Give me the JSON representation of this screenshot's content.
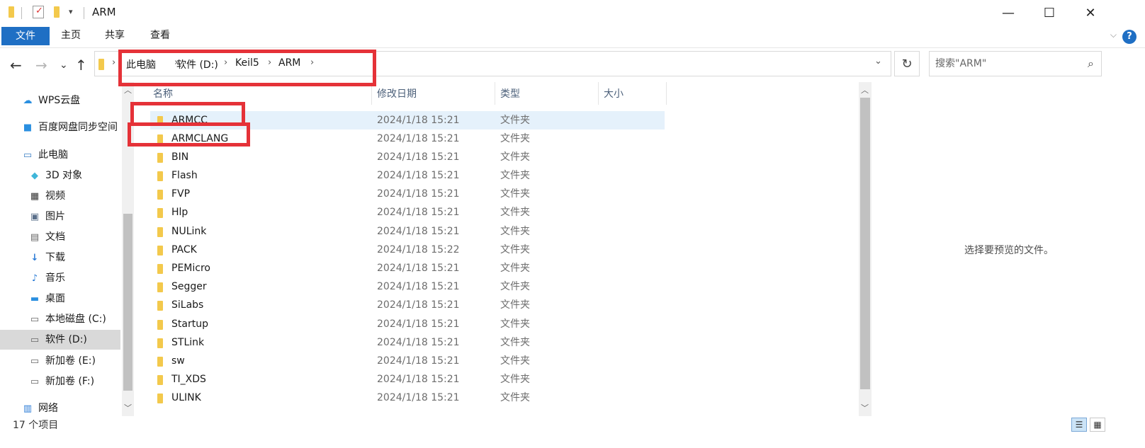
{
  "window": {
    "title": "ARM",
    "quick_access_dropdown": "▾",
    "controls": {
      "minimize": "—",
      "maximize": "☐",
      "close": "✕"
    }
  },
  "ribbon": {
    "tabs": [
      "文件",
      "主页",
      "共享",
      "查看"
    ],
    "help_label": "?",
    "expand_chevron": "⌵"
  },
  "nav": {
    "back": "←",
    "forward": "→",
    "recent": "⌄",
    "up": "↑",
    "breadcrumbs": [
      "此电脑",
      "软件 (D:)",
      "Keil5",
      "ARM"
    ],
    "address_dropdown": "⌄",
    "refresh": "↻",
    "search_placeholder": "搜索\"ARM\""
  },
  "sidebar": {
    "items": [
      {
        "label": "WPS云盘",
        "icon": "cloud-icon"
      },
      {
        "label": "百度网盘同步空间",
        "icon": "baidu-netdisk-icon"
      },
      {
        "label": "此电脑",
        "icon": "computer-icon"
      },
      {
        "label": "3D 对象",
        "icon": "3d-objects-icon"
      },
      {
        "label": "视频",
        "icon": "video-icon"
      },
      {
        "label": "图片",
        "icon": "pictures-icon"
      },
      {
        "label": "文档",
        "icon": "documents-icon"
      },
      {
        "label": "下载",
        "icon": "download-icon"
      },
      {
        "label": "音乐",
        "icon": "music-icon"
      },
      {
        "label": "桌面",
        "icon": "desktop-icon"
      },
      {
        "label": "本地磁盘 (C:)",
        "icon": "drive-icon"
      },
      {
        "label": "软件 (D:)",
        "icon": "drive-icon",
        "selected": true
      },
      {
        "label": "新加卷 (E:)",
        "icon": "drive-icon"
      },
      {
        "label": "新加卷 (F:)",
        "icon": "drive-icon"
      },
      {
        "label": "网络",
        "icon": "network-icon"
      }
    ]
  },
  "list": {
    "columns": [
      "名称",
      "修改日期",
      "类型",
      "大小"
    ],
    "rows": [
      {
        "name": "ARMCC",
        "date": "2024/1/18 15:21",
        "type": "文件夹"
      },
      {
        "name": "ARMCLANG",
        "date": "2024/1/18 15:21",
        "type": "文件夹"
      },
      {
        "name": "BIN",
        "date": "2024/1/18 15:21",
        "type": "文件夹"
      },
      {
        "name": "Flash",
        "date": "2024/1/18 15:21",
        "type": "文件夹"
      },
      {
        "name": "FVP",
        "date": "2024/1/18 15:21",
        "type": "文件夹"
      },
      {
        "name": "Hlp",
        "date": "2024/1/18 15:21",
        "type": "文件夹"
      },
      {
        "name": "NULink",
        "date": "2024/1/18 15:21",
        "type": "文件夹"
      },
      {
        "name": "PACK",
        "date": "2024/1/18 15:22",
        "type": "文件夹"
      },
      {
        "name": "PEMicro",
        "date": "2024/1/18 15:21",
        "type": "文件夹"
      },
      {
        "name": "Segger",
        "date": "2024/1/18 15:21",
        "type": "文件夹"
      },
      {
        "name": "SiLabs",
        "date": "2024/1/18 15:21",
        "type": "文件夹"
      },
      {
        "name": "Startup",
        "date": "2024/1/18 15:21",
        "type": "文件夹"
      },
      {
        "name": "STLink",
        "date": "2024/1/18 15:21",
        "type": "文件夹"
      },
      {
        "name": "sw",
        "date": "2024/1/18 15:21",
        "type": "文件夹"
      },
      {
        "name": "TI_XDS",
        "date": "2024/1/18 15:21",
        "type": "文件夹"
      },
      {
        "name": "ULINK",
        "date": "2024/1/18 15:21",
        "type": "文件夹"
      }
    ]
  },
  "preview": {
    "text": "选择要预览的文件。"
  },
  "status": {
    "count": "17 个项目",
    "view_details": "☰",
    "view_icons": "▦"
  },
  "colors": {
    "accent": "#1f6fc4",
    "annotation_red": "#e53238",
    "folder": "#f3c94c",
    "hover_row": "#e5f1fb",
    "selected_nav": "#d9d9d9"
  }
}
